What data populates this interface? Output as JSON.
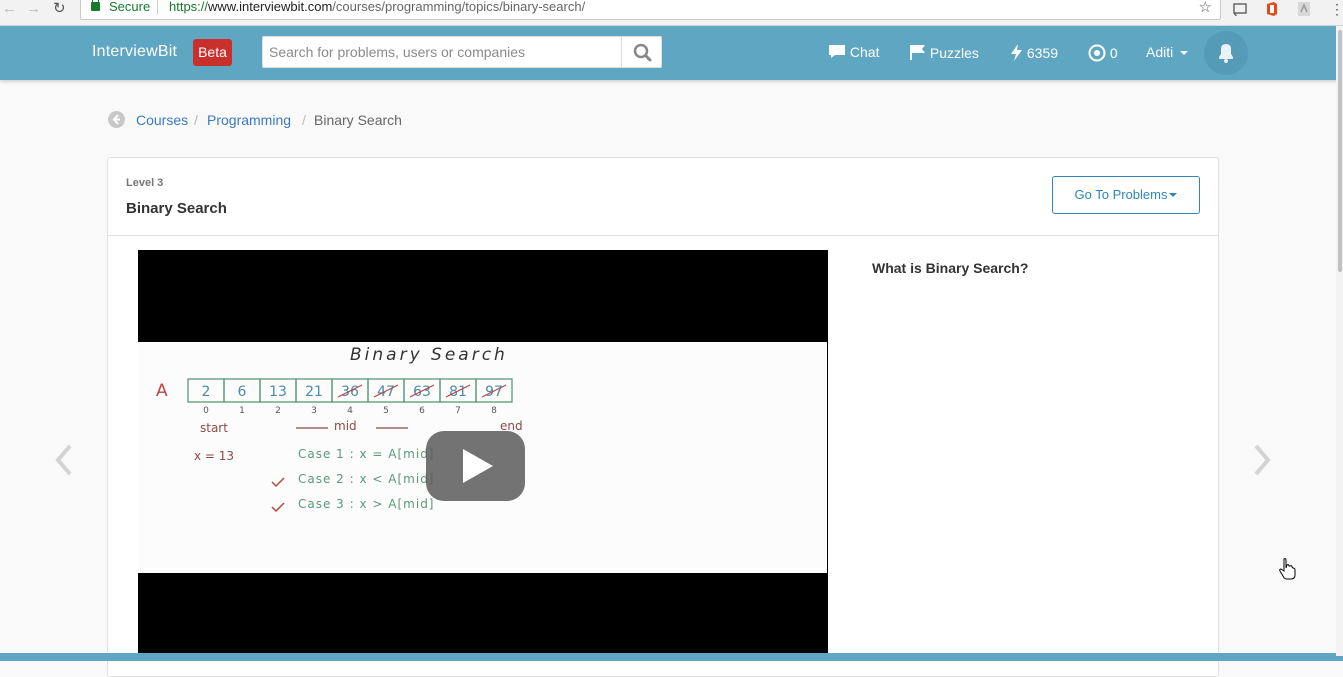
{
  "browser": {
    "secure_label": "Secure",
    "url_scheme": "https://",
    "url_domain": "www.interviewbit.com",
    "url_path": "/courses/programming/topics/binary-search/"
  },
  "nav": {
    "brand": "InterviewBit",
    "badge": "Beta",
    "search_placeholder": "Search for problems, users or companies",
    "chat_label": "Chat",
    "puzzles_label": "Puzzles",
    "score": "6359",
    "streak": "0",
    "user_name": "Aditi"
  },
  "breadcrumb": {
    "items": [
      "Courses",
      "Programming"
    ],
    "current": "Binary Search",
    "separator": "/"
  },
  "topic": {
    "level": "Level 3",
    "title": "Binary Search",
    "goto_label": "Go To Problems"
  },
  "video": {
    "slide": {
      "heading": "Binary Search",
      "array_label": "A",
      "cells": [
        "2",
        "6",
        "13",
        "21",
        "36",
        "47",
        "63",
        "81",
        "97"
      ],
      "indices": [
        "0",
        "1",
        "2",
        "3",
        "4",
        "5",
        "6",
        "7",
        "8"
      ],
      "start_label": "start",
      "mid_label": "mid",
      "end_label": "end",
      "query": "x = 13",
      "cases": [
        "Case 1 :   x = A[mid]",
        "Case 2 :   x < A[mid]",
        "Case 3 :   x > A[mid]"
      ]
    },
    "question": "What is Binary Search?"
  },
  "colors": {
    "nav_bg": "#5fa6c2",
    "badge_bg": "#c9302c",
    "link": "#3b7bbf",
    "button_border": "#2e86b8"
  }
}
